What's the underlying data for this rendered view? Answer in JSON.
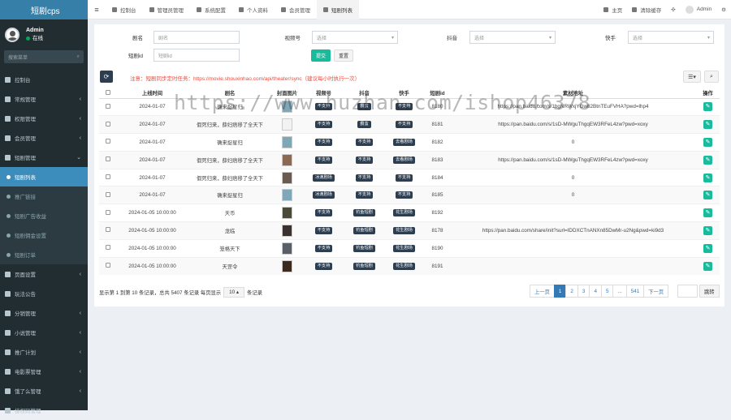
{
  "app": {
    "logo": "短剧cps"
  },
  "user": {
    "name": "Admin",
    "status": "在线"
  },
  "sidebar": {
    "search_placeholder": "搜索菜单",
    "items": [
      {
        "label": "控制台",
        "arrow": "",
        "type": "top"
      },
      {
        "label": "常规管理",
        "arrow": "‹",
        "type": "top"
      },
      {
        "label": "权限管理",
        "arrow": "‹",
        "type": "top"
      },
      {
        "label": "会员管理",
        "arrow": "‹",
        "type": "top"
      },
      {
        "label": "短剧管理",
        "arrow": "⌄",
        "type": "top"
      },
      {
        "label": "短剧列表",
        "arrow": "",
        "type": "active"
      },
      {
        "label": "推广链接",
        "arrow": "",
        "type": "sub"
      },
      {
        "label": "短剧广告收益",
        "arrow": "",
        "type": "sub"
      },
      {
        "label": "短剧佣金设置",
        "arrow": "",
        "type": "sub"
      },
      {
        "label": "短剧订单",
        "arrow": "",
        "type": "sub"
      },
      {
        "label": "页面设置",
        "arrow": "‹",
        "type": "top"
      },
      {
        "label": "玩法公告",
        "arrow": "",
        "type": "top"
      },
      {
        "label": "分销管理",
        "arrow": "‹",
        "type": "top"
      },
      {
        "label": "小说管理",
        "arrow": "‹",
        "type": "top"
      },
      {
        "label": "推广计划",
        "arrow": "‹",
        "type": "top"
      },
      {
        "label": "电影票管理",
        "arrow": "‹",
        "type": "top"
      },
      {
        "label": "饿了么管理",
        "arrow": "‹",
        "type": "top"
      },
      {
        "label": "接权码管理",
        "arrow": "",
        "type": "top"
      }
    ]
  },
  "topbar": {
    "tabs": [
      "控制台",
      "管理员管理",
      "系统配置",
      "个人资料",
      "会员管理",
      "短剧列表"
    ],
    "home": "主页",
    "clear_cache": "清除缓存",
    "admin": "Admin"
  },
  "filters": {
    "name_label": "剧名",
    "name_placeholder": "剧名",
    "video_label": "视频号",
    "video_value": "选择",
    "douyin_label": "抖音",
    "douyin_value": "选择",
    "kuaishou_label": "快手",
    "kuaishou_value": "选择",
    "id_label": "短剧id",
    "id_placeholder": "短剧id",
    "submit": "提交",
    "reset": "重置"
  },
  "notice": "注意：短剧同步定时任务：https://movie.shouxinhao.com/api/theater/sync（建议每小时执行一次）",
  "table": {
    "headers": [
      "上线时间",
      "剧名",
      "封面图片",
      "视频号",
      "抖音",
      "快手",
      "短剧id",
      "素材地址",
      "操作"
    ],
    "rows": [
      {
        "date": "2024-01-07",
        "name": "确来捉星归",
        "cover": "#7fa7b8",
        "video": "不支持",
        "douyin": "霸蛮",
        "kuaishou": "不支持",
        "id": "8180",
        "addr": "https://pan.baidu.com/s/1bgNRWxjYGw82BtnTEuFVHA?pwd=lhp4"
      },
      {
        "date": "2024-01-07",
        "name": "假死归来，薛妇痞移了全天下",
        "cover": "#f2f2f2",
        "video": "不支持",
        "douyin": "霸蛮",
        "kuaishou": "不支持",
        "id": "8181",
        "addr": "https://pan.baidu.com/s/1sD-MWguThgqEW3RFeL4zw?pwd=xoxy"
      },
      {
        "date": "2024-01-07",
        "name": "确来捉星归",
        "cover": "#7fa7b8",
        "video": "不支持",
        "douyin": "不支持",
        "kuaishou": "去看剧场",
        "id": "8182",
        "addr": "0"
      },
      {
        "date": "2024-01-07",
        "name": "假死归来，薛妇痞移了全天下",
        "cover": "#8a6a55",
        "video": "不支持",
        "douyin": "不支持",
        "kuaishou": "去看剧场",
        "id": "8183",
        "addr": "https://pan.baidu.com/s/1sD-MWguThgqEW3RFeL4zw?pwd=xoxy"
      },
      {
        "date": "2024-01-07",
        "name": "假死归来，薛妇痞移了全天下",
        "cover": "#6b5a50",
        "video": "冰滴剧场",
        "douyin": "不支持",
        "kuaishou": "不支持",
        "id": "8184",
        "addr": "0"
      },
      {
        "date": "2024-01-07",
        "name": "确来捉星归",
        "cover": "#7fa7b8",
        "video": "冰滴剧场",
        "douyin": "不支持",
        "kuaishou": "不支持",
        "id": "8185",
        "addr": "0"
      },
      {
        "date": "2024-01-05 10:00:00",
        "name": "天币",
        "cover": "#4a4a3a",
        "video": "不支持",
        "douyin": "钓鱼短剧",
        "kuaishou": "花生剧场",
        "id": "8192",
        "addr": ""
      },
      {
        "date": "2024-01-05 10:00:00",
        "name": "龙临",
        "cover": "#3a3230",
        "video": "不支持",
        "douyin": "钓鱼短剧",
        "kuaishou": "花生剧场",
        "id": "8178",
        "addr": "https://pan.baidu.com/share/init?surl=IDDXCTnANXn85DwMr-u2Ng&pwd=ki9d3"
      },
      {
        "date": "2024-01-05 10:00:00",
        "name": "笼格天下",
        "cover": "#5a5e66",
        "video": "不支持",
        "douyin": "钓鱼短剧",
        "kuaishou": "花生剧场",
        "id": "8190",
        "addr": ""
      },
      {
        "date": "2024-01-05 10:00:00",
        "name": "天罡令",
        "cover": "#3b2a1f",
        "video": "不支持",
        "douyin": "钓鱼短剧",
        "kuaishou": "花生剧场",
        "id": "8191",
        "addr": ""
      }
    ]
  },
  "pagination": {
    "summary_pre": "显示第 1 到第 10 条记录，总共 5407 条记录 每页显示",
    "page_size": "10 ▴",
    "summary_post": "条记录",
    "pages": [
      "上一页",
      "1",
      "2",
      "3",
      "4",
      "5",
      "...",
      "541",
      "下一页"
    ],
    "jump": "跳转"
  },
  "watermark": "https://www.huzhan.com/ishop46378",
  "colors": {
    "accent": "#3c8dbc",
    "sidebar": "#222d32",
    "success": "#18bc9c",
    "badge": "#2c3e50",
    "notice": "#e74c3c"
  }
}
